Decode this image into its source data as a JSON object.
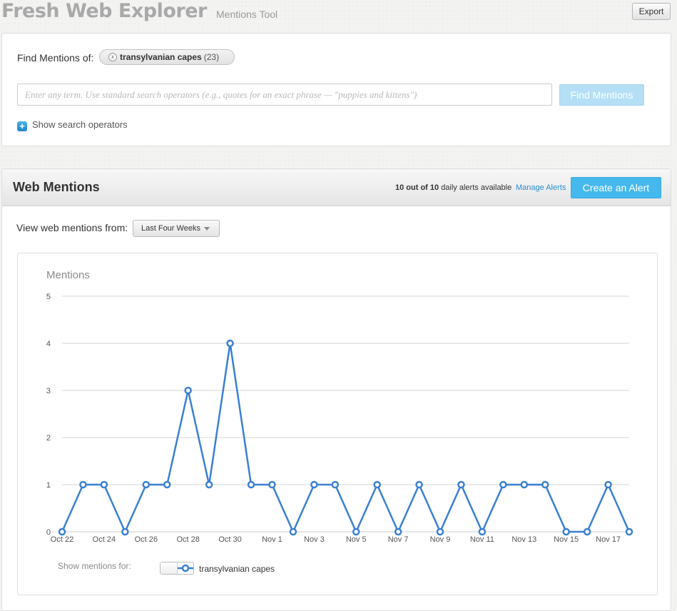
{
  "header": {
    "title": "Fresh Web Explorer",
    "subtitle": "Mentions Tool",
    "export_label": "Export"
  },
  "search": {
    "find_label": "Find Mentions of:",
    "chip_term": "transylvanian capes",
    "chip_count": "(23)",
    "chip_remove": "x",
    "placeholder": "Enter any term. Use standard search operators (e.g., quotes for an exact phrase — \"puppies and kittens\")",
    "value": "",
    "find_button": "Find Mentions",
    "operators_toggle": "Show search operators"
  },
  "mentions": {
    "title": "Web Mentions",
    "alerts_used": "10 out of 10",
    "alerts_suffix": "daily alerts available",
    "manage_link": "Manage Alerts",
    "create_button": "Create an Alert",
    "view_label": "View web mentions from:",
    "range_selected": "Last Four Weeks",
    "legend_label": "Show mentions for:",
    "legend_series": "transylvanian capes"
  },
  "colors": {
    "series": "#3a80d2",
    "accent": "#45b9ee",
    "link": "#2a8fd0"
  },
  "chart_data": {
    "type": "line",
    "title": "Mentions",
    "xlabel": "",
    "ylabel": "",
    "ylim": [
      0,
      5
    ],
    "yticks": [
      0,
      1,
      2,
      3,
      4,
      5
    ],
    "grid": true,
    "x": [
      "Oct 22",
      "Oct 23",
      "Oct 24",
      "Oct 25",
      "Oct 26",
      "Oct 27",
      "Oct 28",
      "Oct 29",
      "Oct 30",
      "Oct 31",
      "Nov 1",
      "Nov 2",
      "Nov 3",
      "Nov 4",
      "Nov 5",
      "Nov 6",
      "Nov 7",
      "Nov 8",
      "Nov 9",
      "Nov 10",
      "Nov 11",
      "Nov 12",
      "Nov 13",
      "Nov 14",
      "Nov 15",
      "Nov 16",
      "Nov 17",
      "Nov 18"
    ],
    "xtick_labels": [
      "Oct 22",
      "Oct 24",
      "Oct 26",
      "Oct 28",
      "Oct 30",
      "Nov 1",
      "Nov 3",
      "Nov 5",
      "Nov 7",
      "Nov 9",
      "Nov 11",
      "Nov 13",
      "Nov 15",
      "Nov 17"
    ],
    "series": [
      {
        "name": "transylvanian capes",
        "values": [
          0,
          1,
          1,
          0,
          1,
          1,
          3,
          1,
          4,
          1,
          1,
          0,
          1,
          1,
          0,
          1,
          0,
          1,
          0,
          1,
          0,
          1,
          1,
          1,
          0,
          0,
          1,
          0
        ]
      }
    ]
  }
}
